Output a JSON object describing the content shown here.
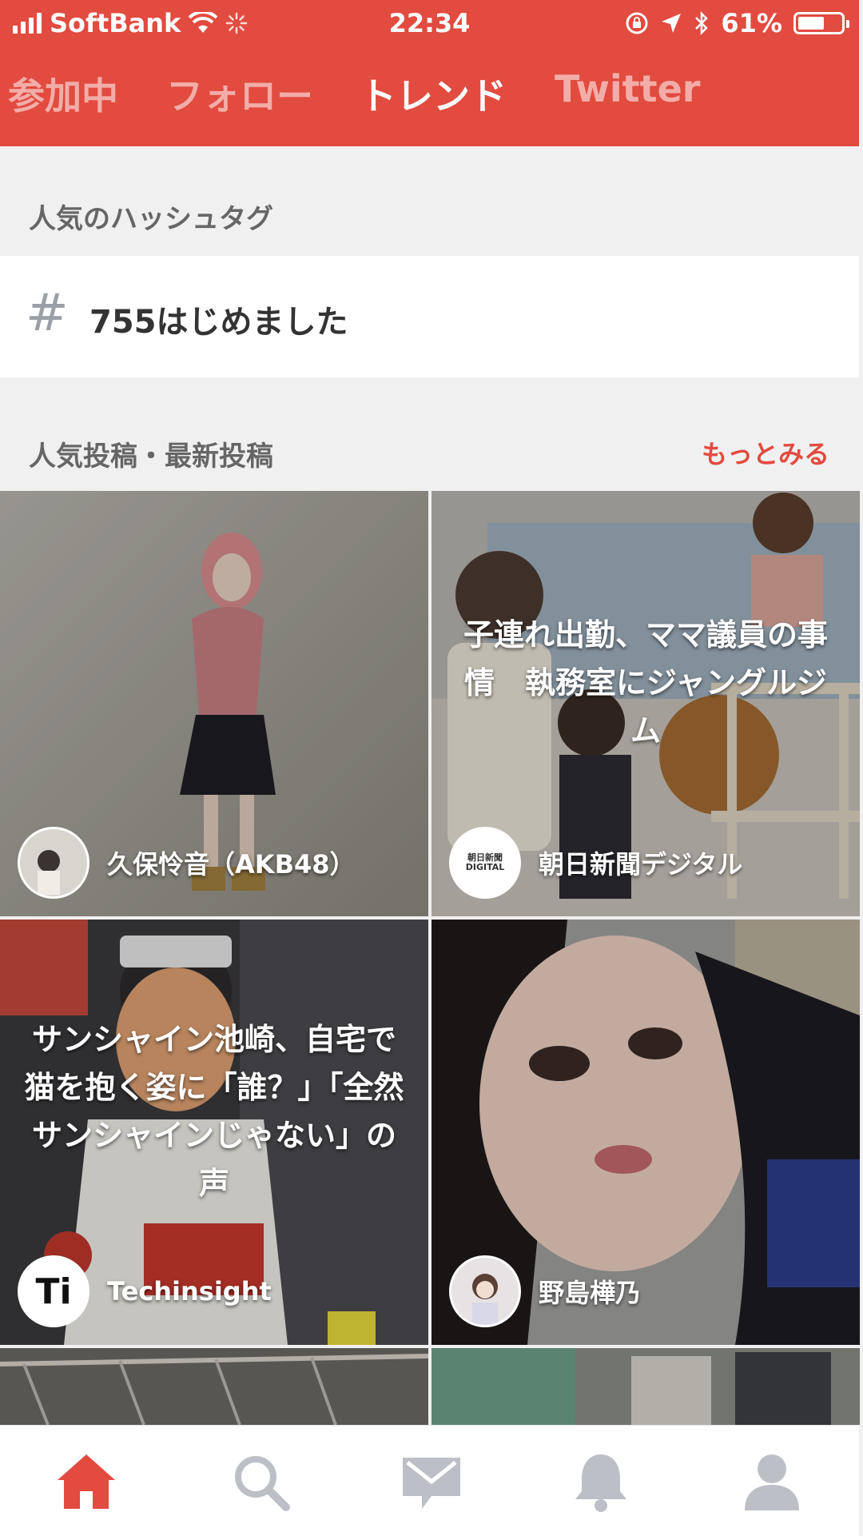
{
  "status": {
    "carrier": "SoftBank",
    "time": "22:34",
    "battery": "61%",
    "battery_level": 0.61
  },
  "tabs": [
    {
      "label": "参加中",
      "active": false
    },
    {
      "label": "フォロー",
      "active": false
    },
    {
      "label": "トレンド",
      "active": true
    },
    {
      "label": "Twitter",
      "active": false
    }
  ],
  "hashtags": {
    "heading": "人気のハッシュタグ",
    "items": [
      {
        "symbol": "#",
        "tag": "755はじめました"
      }
    ]
  },
  "posts": {
    "heading": "人気投稿・最新投稿",
    "more": "もっとみる",
    "items": [
      {
        "headline": "",
        "author": "久保怜音（AKB48）"
      },
      {
        "headline": "子連れ出勤、ママ議員の事情　執務室にジャングルジム",
        "author": "朝日新聞デジタル"
      },
      {
        "headline": "サンシャイン池崎、自宅で猫を抱く姿に「誰？」「全然サンシャインじゃない」の声",
        "author": "Techinsight"
      },
      {
        "headline": "",
        "author": "野島樺乃"
      }
    ]
  },
  "avatar_text": {
    "asahi": "朝日新聞\nDIGITAL",
    "techinsight": "Ti"
  },
  "colors": {
    "accent": "#e24b3f",
    "nav_active": "#e24b3f",
    "nav_inactive": "#bcc0c6"
  },
  "nav": [
    {
      "icon": "home-icon",
      "active": true
    },
    {
      "icon": "search-icon",
      "active": false
    },
    {
      "icon": "mail-icon",
      "active": false
    },
    {
      "icon": "bell-icon",
      "active": false
    },
    {
      "icon": "profile-icon",
      "active": false
    }
  ]
}
